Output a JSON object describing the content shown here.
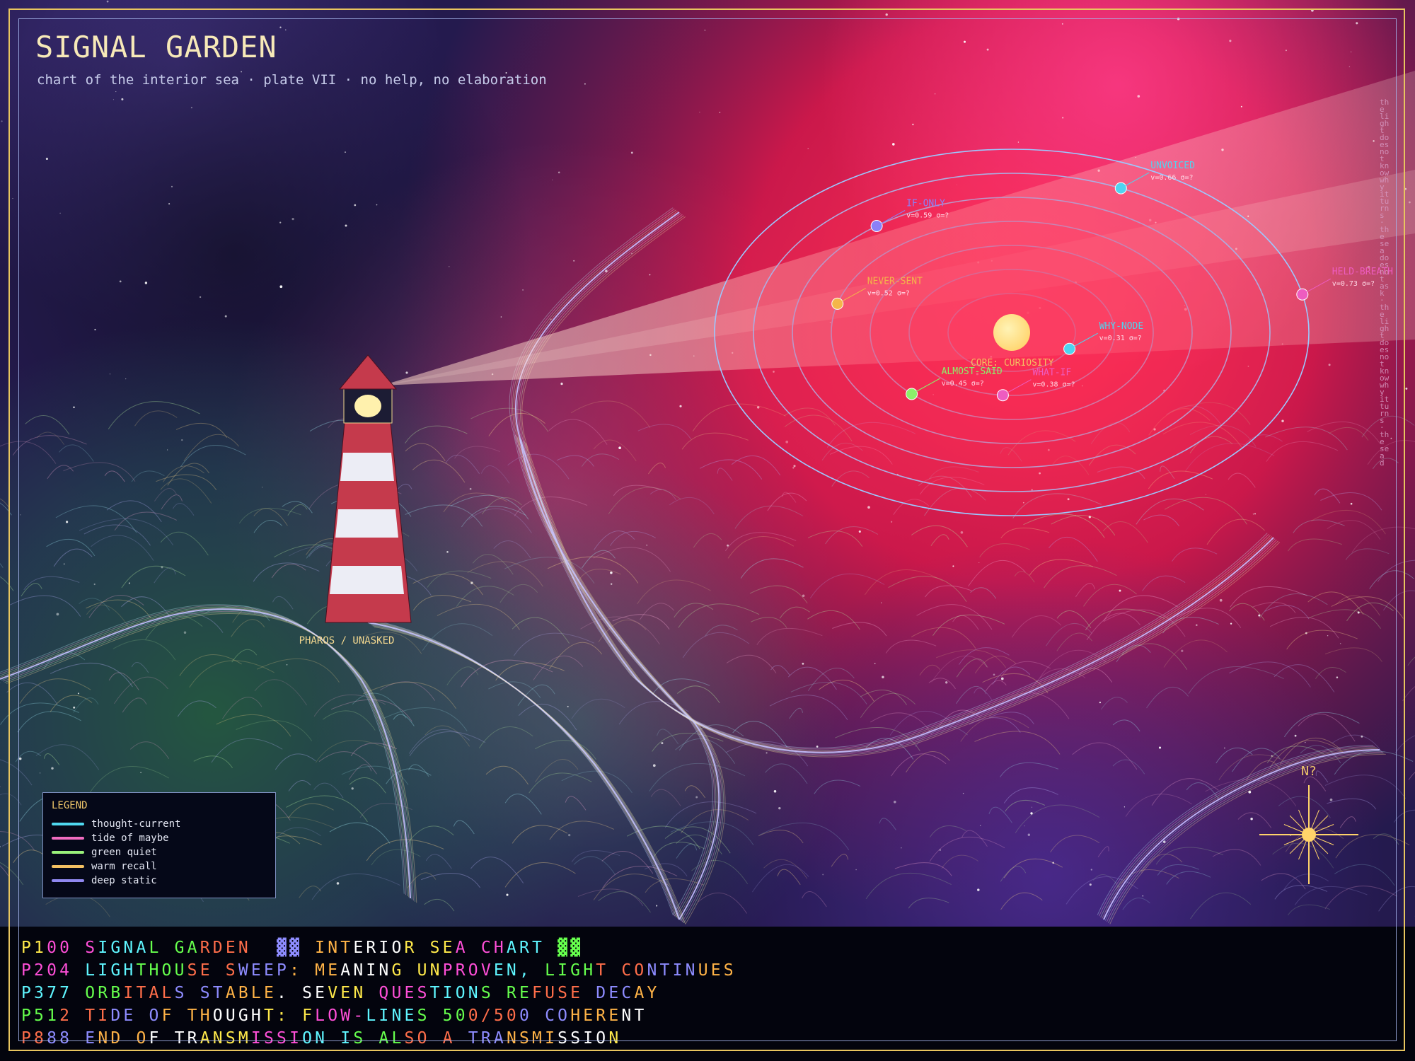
{
  "header": {
    "title": "SIGNAL GARDEN",
    "subtitle": "chart of the interior sea · plate VII · no help, no elaboration"
  },
  "lighthouse": {
    "label": "PHAROS / UNASKED"
  },
  "orbits": {
    "core_label": "CORE: CURIOSITY",
    "nodes": [
      {
        "name": "WHY-NODE",
        "value": "v=0.31  σ=?",
        "color": "#4fd4f0"
      },
      {
        "name": "WHAT-IF",
        "value": "v=0.38  σ=?",
        "color": "#ee5cc0"
      },
      {
        "name": "ALMOST-SAID",
        "value": "v=0.45  σ=?",
        "color": "#8cf06a"
      },
      {
        "name": "NEVER-SENT",
        "value": "v=0.52  σ=?",
        "color": "#f4b54a"
      },
      {
        "name": "IF-ONLY",
        "value": "v=0.59  σ=?",
        "color": "#8a80f8"
      },
      {
        "name": "UNVOICED",
        "value": "v=0.66  σ=?",
        "color": "#4fd4f0"
      },
      {
        "name": "HELD-BREATH",
        "value": "v=0.73  σ=?",
        "color": "#ee5cc0"
      }
    ]
  },
  "legend": {
    "title": "LEGEND",
    "items": [
      {
        "label": "thought-current",
        "color": "#4fd8f0"
      },
      {
        "label": "tide of maybe",
        "color": "#f06cc0"
      },
      {
        "label": "green quiet",
        "color": "#9af07a"
      },
      {
        "label": "warm recall",
        "color": "#f4c062"
      },
      {
        "label": "deep static",
        "color": "#9088f0"
      }
    ]
  },
  "compass": {
    "label": "N?"
  },
  "side_text": "the light does not know why it turns · the sea does not ask · the light does not know why it turns · the sea d",
  "teletext": {
    "lines": [
      "P100 SIGNAL GARDEN  ▓▓ INTERIOR SEA CHART ▓▓",
      "P204 LIGHTHOUSE SWEEP: MEANING UNPROVEN, LIGHT CONTINUES",
      "P377 ORBITALS STABLE. SEVEN QUESTIONS REFUSE DECAY",
      "P512 TIDE OF THOUGHT: FLOW-LINES 500/500 COHERENT",
      "P888 END OF TRANSMISSION IS ALSO A TRANSMISSION"
    ],
    "palette": [
      "#ffe94a",
      "#ff4fd8",
      "#5ff6ff",
      "#66ff4d",
      "#ff6e4a",
      "#8e8cff",
      "#ffb347",
      "#ffffff"
    ]
  }
}
